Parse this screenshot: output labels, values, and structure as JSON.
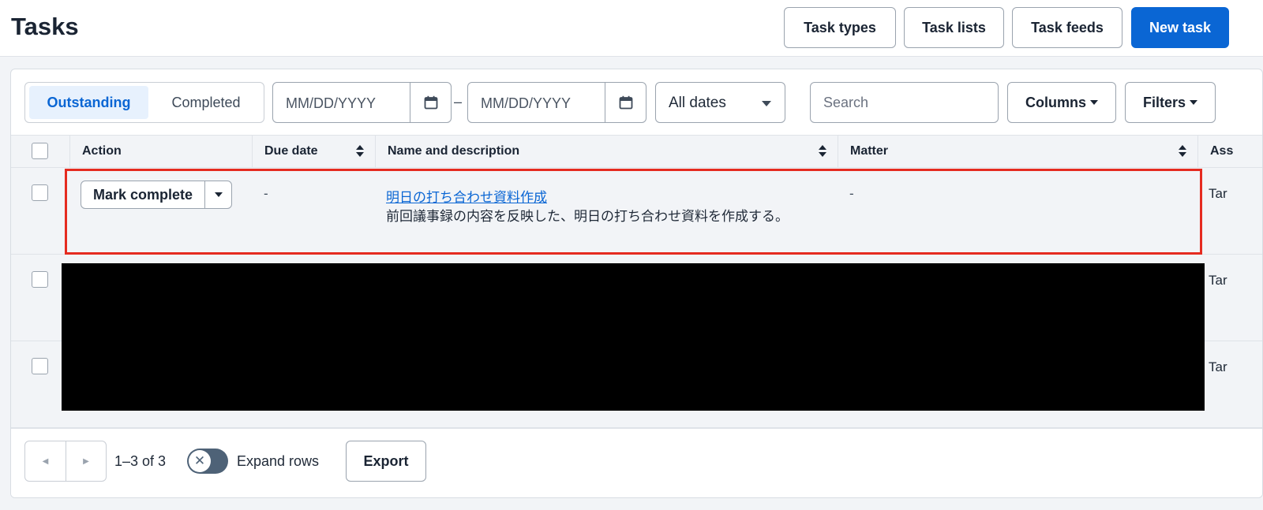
{
  "header": {
    "title": "Tasks",
    "buttons": {
      "task_types": "Task types",
      "task_lists": "Task lists",
      "task_feeds": "Task feeds",
      "new_task": "New task"
    }
  },
  "filters": {
    "status_tabs": [
      {
        "label": "Outstanding",
        "active": true
      },
      {
        "label": "Completed",
        "active": false
      }
    ],
    "date_from": {
      "placeholder": "MM/DD/YYYY",
      "icon": "calendar-icon"
    },
    "date_separator": "–",
    "date_to": {
      "placeholder": "MM/DD/YYYY",
      "icon": "calendar-icon"
    },
    "date_range": {
      "selected": "All dates"
    },
    "search": {
      "placeholder": "Search"
    },
    "columns_label": "Columns",
    "filters_label": "Filters"
  },
  "table": {
    "columns": [
      "Action",
      "Due date",
      "Name and description",
      "Matter",
      "Ass"
    ],
    "rows": [
      {
        "action_label": "Mark complete",
        "due_date": "-",
        "name": "明日の打ち合わせ資料作成",
        "description": "前回議事録の内容を反映した、明日の打ち合わせ資料を作成する。",
        "matter": "-",
        "assignee": "Tar",
        "highlighted": true
      },
      {
        "assignee": "Tar",
        "redacted": true
      },
      {
        "assignee": "Tar",
        "redacted": true
      }
    ]
  },
  "footer": {
    "range": "1–3 of 3",
    "expand_rows_label": "Expand rows",
    "expand_rows_on": false,
    "export_label": "Export"
  },
  "colors": {
    "accent": "#0a66d4",
    "highlight": "#e52b20"
  }
}
